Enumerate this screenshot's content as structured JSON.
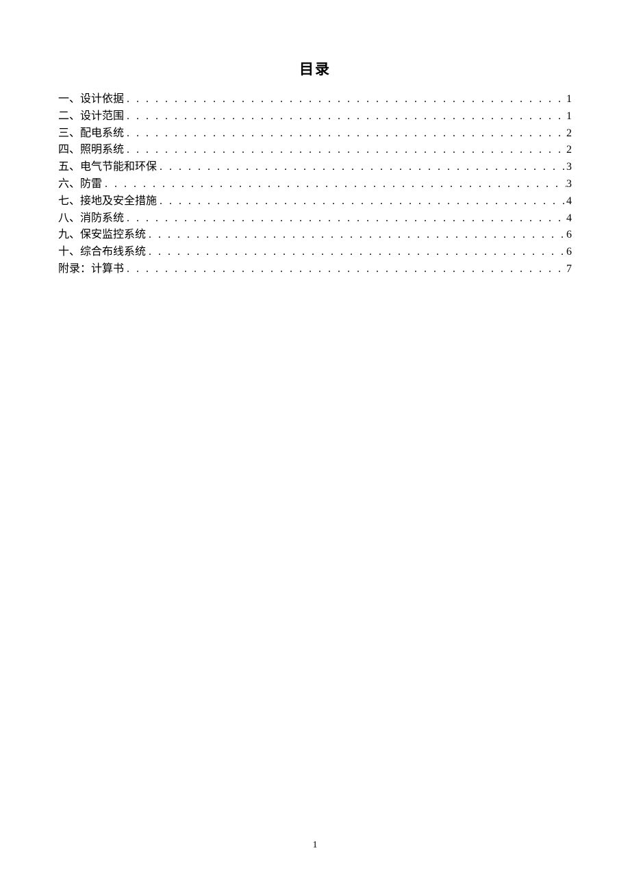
{
  "title": "目录",
  "toc": [
    {
      "label": "一、设计依据",
      "page": "1"
    },
    {
      "label": "二、设计范围",
      "page": "1"
    },
    {
      "label": "三、配电系统",
      "page": "2"
    },
    {
      "label": "四、照明系统",
      "page": "2"
    },
    {
      "label": "五、电气节能和环保",
      "page": "3"
    },
    {
      "label": "六、防雷",
      "page": "3"
    },
    {
      "label": "七、接地及安全措施",
      "page": "4"
    },
    {
      "label": "八、消防系统",
      "page": "4"
    },
    {
      "label": "九、保安监控系统",
      "page": "6"
    },
    {
      "label": "十、综合布线系统",
      "page": "6"
    },
    {
      "label": "附录：计算书",
      "page": "7"
    }
  ],
  "page_number": "1"
}
